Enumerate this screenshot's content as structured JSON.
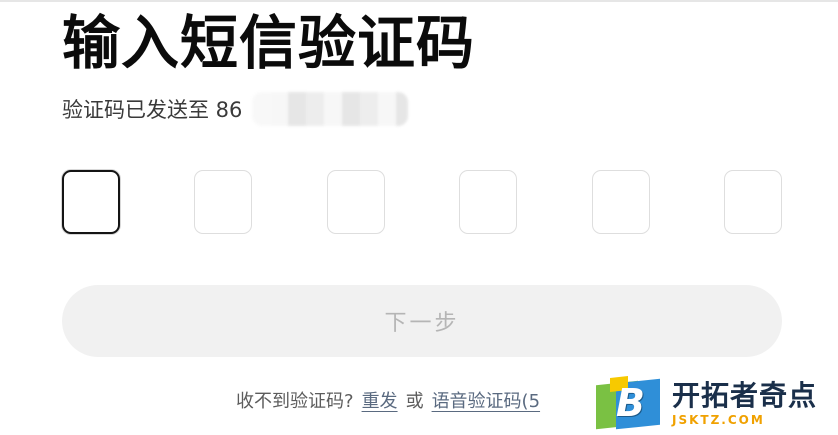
{
  "header": {
    "title": "输入短信验证码",
    "subtitle_prefix": "验证码已发送至 86"
  },
  "code_input": {
    "length": 6,
    "values": [
      "",
      "",
      "",
      "",
      "",
      ""
    ],
    "active_index": 0
  },
  "actions": {
    "next_label": "下一步"
  },
  "footer": {
    "prompt": "收不到验证码?",
    "resend_label": "重发",
    "or_text": "或",
    "voice_label": "语音验证码(5"
  },
  "watermark": {
    "name_cn": "开拓者奇点",
    "domain": "JSKTZ.COM",
    "letter": "B"
  },
  "colors": {
    "title": "#0b0b0b",
    "button_bg": "#f1f1f1",
    "button_text": "#b5b5b5",
    "link": "#5a6a80",
    "active_border": "#141414"
  }
}
